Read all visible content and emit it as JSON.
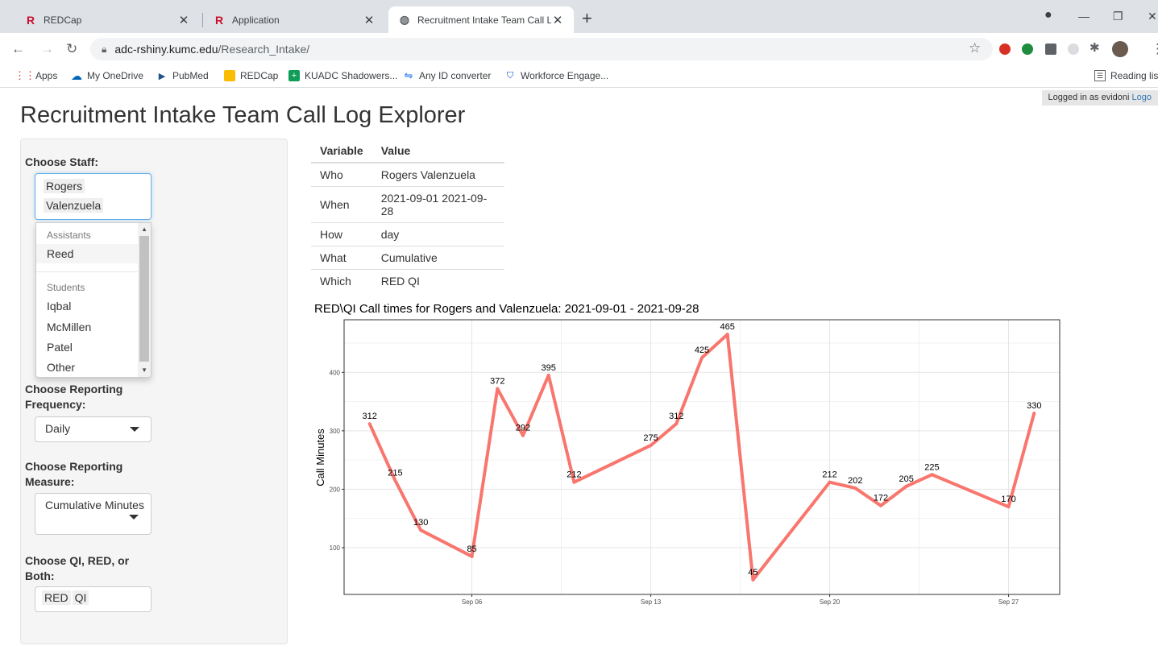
{
  "browser": {
    "tabs": [
      {
        "title": "REDCap",
        "active": false
      },
      {
        "title": "Application",
        "active": false
      },
      {
        "title": "Recruitment Intake Team Call Log",
        "active": true
      }
    ],
    "url_host": "adc-rshiny.kumc.edu",
    "url_path": "/Research_Intake/",
    "bookmarks": [
      "Apps",
      "My OneDrive",
      "PubMed",
      "REDCap",
      "KUADC Shadowers...",
      "Any ID converter",
      "Workforce Engage..."
    ],
    "reading_list": "Reading lis"
  },
  "page": {
    "logged_in_text": "Logged in as evidoni",
    "logout_text": "Logo",
    "title": "Recruitment Intake Team Call Log Explorer"
  },
  "sidebar": {
    "staff_label": "Choose Staff:",
    "staff_selected": [
      "Rogers",
      "Valenzuela"
    ],
    "dropdown": {
      "groups": [
        {
          "label": "Assistants",
          "items": [
            "Reed"
          ]
        },
        {
          "label": "Students",
          "items": [
            "Iqbal",
            "McMillen",
            "Patel",
            "Other"
          ]
        }
      ]
    },
    "frequency_label": "Choose Reporting Frequency:",
    "frequency_value": "Daily",
    "measure_label": "Choose Reporting Measure:",
    "measure_value": "Cumulative Minutes",
    "type_label": "Choose QI, RED, or Both:",
    "type_selected": [
      "RED",
      "QI"
    ]
  },
  "table": {
    "headers": [
      "Variable",
      "Value"
    ],
    "rows": [
      [
        "Who",
        "Rogers Valenzuela"
      ],
      [
        "When",
        "2021-09-01 2021-09-28"
      ],
      [
        "How",
        "day"
      ],
      [
        "What",
        "Cumulative"
      ],
      [
        "Which",
        "RED QI"
      ]
    ]
  },
  "colors": {
    "line": "#f8766d",
    "focus": "#66afe9",
    "link": "#337ab7"
  },
  "chart_data": {
    "type": "line",
    "title": "RED\\QI Call times for  Rogers and Valenzuela: 2021-09-01 - 2021-09-28",
    "ylabel": "Call Minutes",
    "xlabel": "",
    "x": [
      "2021-09-02",
      "2021-09-03",
      "2021-09-04",
      "2021-09-06",
      "2021-09-07",
      "2021-09-08",
      "2021-09-09",
      "2021-09-10",
      "2021-09-13",
      "2021-09-14",
      "2021-09-15",
      "2021-09-16",
      "2021-09-17",
      "2021-09-20",
      "2021-09-21",
      "2021-09-22",
      "2021-09-23",
      "2021-09-24",
      "2021-09-27",
      "2021-09-28"
    ],
    "values": [
      312,
      215,
      130,
      85,
      372,
      292,
      395,
      212,
      275,
      312,
      425,
      465,
      45,
      212,
      202,
      172,
      205,
      225,
      170,
      330
    ],
    "x_ticks": [
      "Sep 06",
      "Sep 13",
      "Sep 20",
      "Sep 27"
    ],
    "x_tick_dates": [
      "2021-09-06",
      "2021-09-13",
      "2021-09-20",
      "2021-09-27"
    ],
    "y_ticks": [
      100,
      200,
      300,
      400
    ],
    "xlim": [
      "2021-09-01",
      "2021-09-29"
    ],
    "ylim": [
      20,
      490
    ],
    "grid": true,
    "legend": "none"
  }
}
